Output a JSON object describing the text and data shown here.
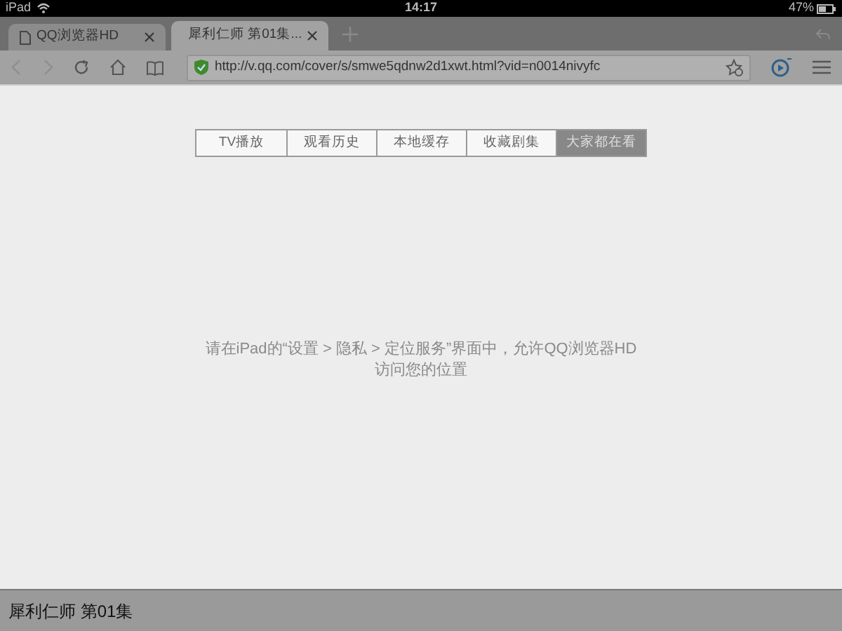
{
  "status_bar": {
    "carrier": "iPad",
    "time": "14:17",
    "battery": "47%"
  },
  "browser_tabs": [
    {
      "label": "QQ浏览器HD",
      "selected": false,
      "kind": "page"
    },
    {
      "label": "犀利仁师 第01集...",
      "selected": true,
      "kind": "video"
    }
  ],
  "address_bar": {
    "url": "http://v.qq.com/cover/s/smwe5qdnw2d1xwt.html?vid=n0014nivyfc"
  },
  "segments": [
    {
      "label": "TV播放",
      "selected": false
    },
    {
      "label": "观看历史",
      "selected": false
    },
    {
      "label": "本地缓存",
      "selected": false
    },
    {
      "label": "收藏剧集",
      "selected": false
    },
    {
      "label": "大家都在看",
      "selected": true
    }
  ],
  "message": [
    "请在iPad的“设置 > 隐私 > 定位服务”界面中，允许QQ浏览器HD",
    "访问您的位置"
  ],
  "bottom_bar": {
    "title": "犀利仁师 第01集"
  }
}
